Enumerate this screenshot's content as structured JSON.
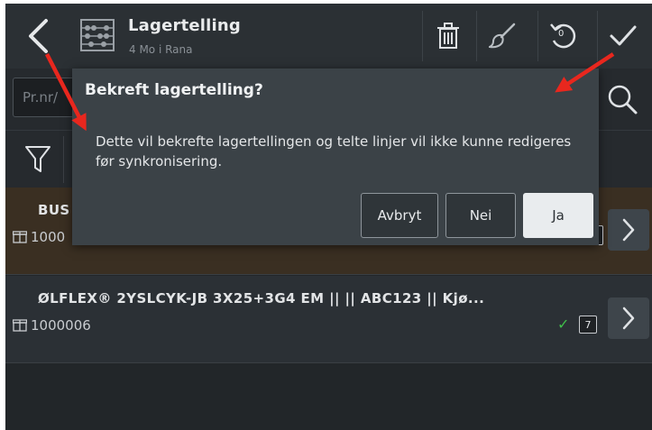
{
  "header": {
    "title": "Lagertelling",
    "subtitle": "4 Mo i Rana",
    "reset_badge": "0",
    "icons": {
      "back": "chevron-left-icon",
      "app": "abacus-icon",
      "delete": "trash-icon",
      "brush": "brush-icon",
      "reset": "undo-icon",
      "confirm": "checkmark-icon"
    }
  },
  "search": {
    "placeholder": "Pr.nr/",
    "icon": "search-icon"
  },
  "filter": {
    "icon": "filter-icon"
  },
  "list": {
    "items": [
      {
        "name": "BUS",
        "id": "1000",
        "icon": "box-icon"
      },
      {
        "name": "ØLFLEX® 2YSLCYK-JB 3X25+3G4 EM ||    || ABC123 || Kjø...",
        "id": "1000006",
        "count": "7",
        "icon": "box-icon"
      }
    ]
  },
  "dialog": {
    "title": "Bekreft lagertelling?",
    "message": "Dette vil bekrefte lagertellingen og telte linjer vil ikke kunne redigeres før synkronisering.",
    "buttons": {
      "cancel": "Avbryt",
      "no": "Nei",
      "yes": "Ja"
    }
  },
  "colors": {
    "background": "#222629",
    "header": "#2b3034",
    "dialog": "#3b4247",
    "highlight_row": "#3a2f22",
    "primary_button": "#e9ecee",
    "check": "#3fbf4a",
    "annotation": "#e8271e"
  }
}
